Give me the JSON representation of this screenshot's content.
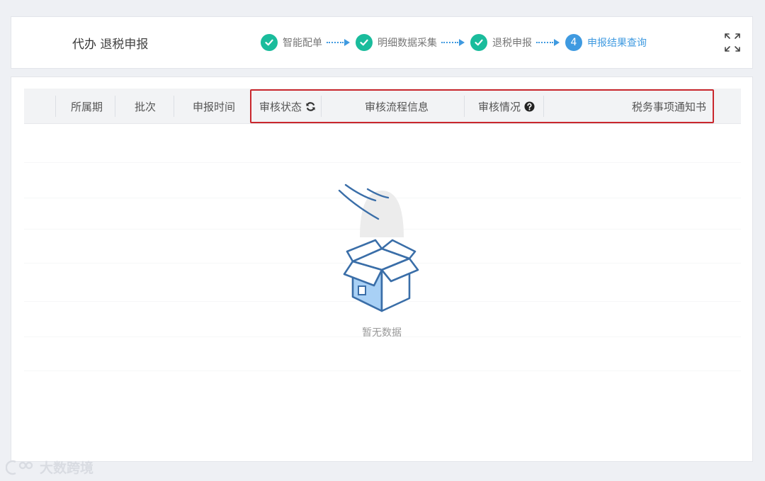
{
  "header": {
    "title_prefix": "代办",
    "title": "退税申报"
  },
  "steps": [
    {
      "label": "智能配单",
      "state": "done",
      "icon": "check-icon"
    },
    {
      "label": "明细数据采集",
      "state": "done",
      "icon": "check-icon"
    },
    {
      "label": "退税申报",
      "state": "done",
      "icon": "check-icon"
    },
    {
      "label": "申报结果查询",
      "state": "current",
      "number": "4"
    }
  ],
  "expand_icon": "fullscreen-expand-icon",
  "table": {
    "columns": [
      {
        "label": "所属期"
      },
      {
        "label": "批次"
      },
      {
        "label": "申报时间"
      },
      {
        "label": "审核状态",
        "icon": "refresh-icon"
      },
      {
        "label": "审核流程信息"
      },
      {
        "label": "审核情况",
        "icon": "help-icon"
      },
      {
        "label": "税务事项通知书"
      }
    ],
    "empty_text": "暂无数据"
  },
  "watermark": {
    "text": "大数跨境"
  },
  "colors": {
    "done": "#1abc9c",
    "current": "#3f9ae0",
    "highlight": "#c9272d"
  }
}
